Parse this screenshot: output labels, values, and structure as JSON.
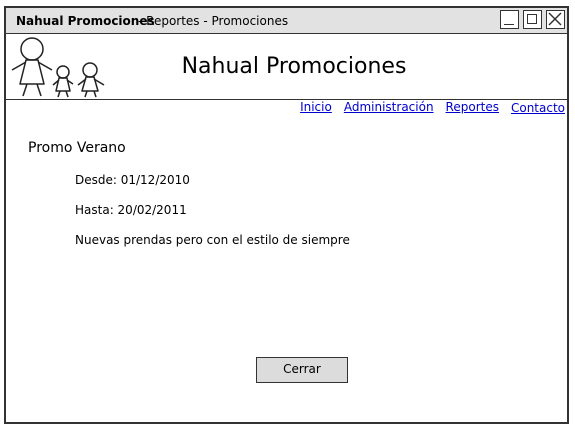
{
  "window": {
    "app_name": "Nahual Promociones",
    "breadcrumb": "- Reportes - Promociones"
  },
  "header": {
    "title": "Nahual Promociones",
    "logo_icon": "family-stick-figures-icon"
  },
  "nav": {
    "items": [
      {
        "label": "Inicio"
      },
      {
        "label": "Administración"
      },
      {
        "label": "Reportes"
      },
      {
        "label": "Contacto"
      }
    ]
  },
  "promo": {
    "name": "Promo Verano",
    "desde": "Desde: 01/12/2010",
    "hasta": "Hasta: 20/02/2011",
    "descripcion": "Nuevas prendas pero con el estilo de siempre"
  },
  "actions": {
    "close_label": "Cerrar"
  },
  "colors": {
    "titlebar": "#e2e2e2",
    "link": "#0000cc",
    "button": "#dcdcdc"
  }
}
